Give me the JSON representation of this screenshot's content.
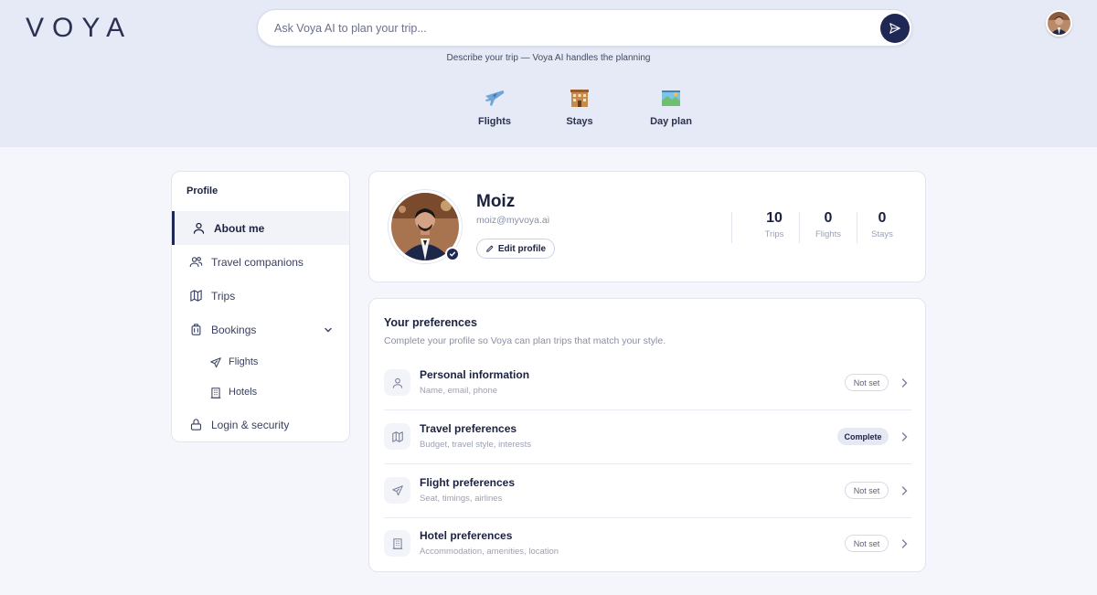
{
  "brand": {
    "logo": "VOYA"
  },
  "search": {
    "placeholder": "Ask Voya AI to plan your trip...",
    "tagline": "Describe your trip — Voya AI handles the planning"
  },
  "categories": [
    {
      "label": "Flights",
      "icon": "airplane-icon"
    },
    {
      "label": "Stays",
      "icon": "hotel-icon"
    },
    {
      "label": "Day plan",
      "icon": "map-icon"
    }
  ],
  "sidebar": {
    "title": "Profile",
    "items": [
      {
        "label": "About me",
        "icon": "user-icon",
        "active": true
      },
      {
        "label": "Travel companions",
        "icon": "users-icon"
      },
      {
        "label": "Trips",
        "icon": "map-icon"
      },
      {
        "label": "Bookings",
        "icon": "luggage-icon",
        "expanded": true
      },
      {
        "label": "Flights",
        "icon": "plane-icon",
        "sub": true
      },
      {
        "label": "Hotels",
        "icon": "building-icon",
        "sub": true
      },
      {
        "label": "Login & security",
        "icon": "lock-icon"
      }
    ]
  },
  "profile": {
    "name": "Moiz",
    "email": "moiz@myvoya.ai",
    "edit_label": "Edit profile",
    "stats": [
      {
        "value": "10",
        "label": "Trips"
      },
      {
        "value": "0",
        "label": "Flights"
      },
      {
        "value": "0",
        "label": "Stays"
      }
    ]
  },
  "preferences": {
    "title": "Your preferences",
    "subtitle": "Complete your profile so Voya can plan trips that match your style.",
    "rows": [
      {
        "name": "Personal information",
        "desc": "Name, email, phone",
        "status": "Not set",
        "icon": "user-icon"
      },
      {
        "name": "Travel preferences",
        "desc": "Budget, travel style, interests",
        "status": "Complete",
        "icon": "map-icon"
      },
      {
        "name": "Flight preferences",
        "desc": "Seat, timings, airlines",
        "status": "Not set",
        "icon": "plane-icon"
      },
      {
        "name": "Hotel preferences",
        "desc": "Accommodation, amenities, location",
        "status": "Not set",
        "icon": "building-icon"
      }
    ]
  },
  "colors": {
    "accent": "#1f2755",
    "hero_bg": "#e6eaf6",
    "page_bg": "#f4f6fb"
  }
}
